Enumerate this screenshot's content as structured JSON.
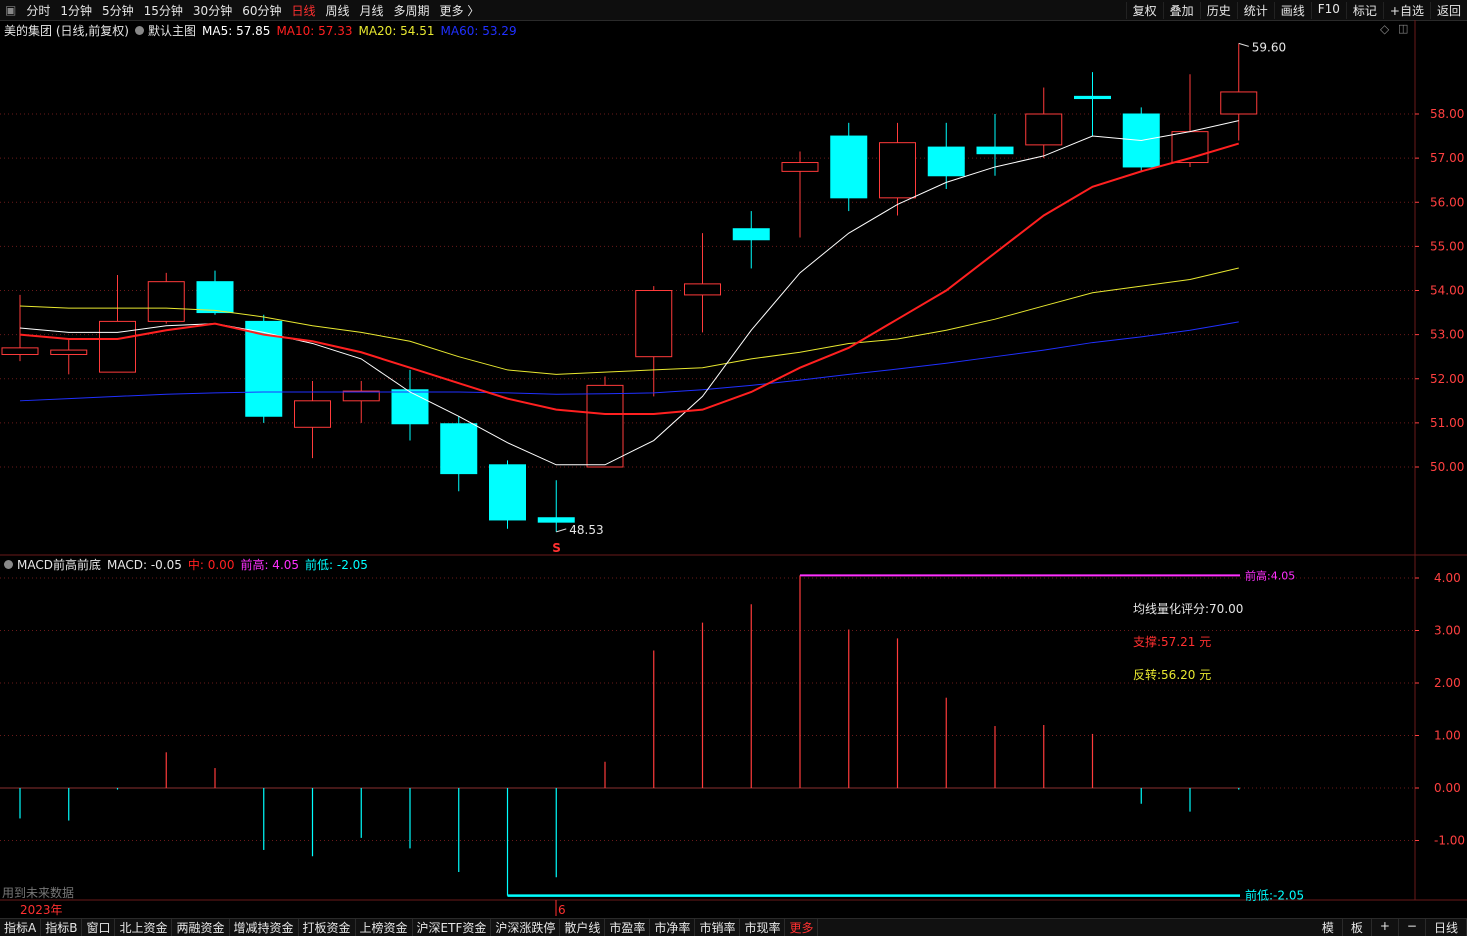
{
  "toolbar": {
    "periods": [
      "分时",
      "1分钟",
      "5分钟",
      "15分钟",
      "30分钟",
      "60分钟",
      "日线",
      "周线",
      "月线",
      "多周期",
      "更多 〉"
    ],
    "active_period": "日线",
    "right_items": [
      "复权",
      "叠加",
      "历史",
      "统计",
      "画线",
      "F10",
      "标记",
      "+自选",
      "返回"
    ]
  },
  "main_legend": {
    "title": "美的集团 (日线,前复权)",
    "indicator": "默认主图",
    "ma5": "MA5: 57.85",
    "ma10": "MA10: 57.33",
    "ma20": "MA20: 54.51",
    "ma60": "MA60: 53.29"
  },
  "macd_legend": {
    "title": "MACD前高前底",
    "macd": "MACD: -0.05",
    "mid": "中: 0.00",
    "high": "前高: 4.05",
    "low": "前低: -2.05"
  },
  "annotations": {
    "high_label": "59.60",
    "low_label": "48.53",
    "score": "均线量化评分:70.00",
    "support": "支撑:57.21 元",
    "reversal": "反转:56.20 元",
    "prev_high_tag": "前高:4.05",
    "prev_low_tag": "前低:-2.05",
    "future_data": "用到未来数据",
    "year_label": "2023年",
    "month_label": "6",
    "s_marker": "S"
  },
  "bottom_bar": {
    "items": [
      "指标A",
      "指标B",
      "窗口",
      "北上资金",
      "两融资金",
      "增减持资金",
      "打板资金",
      "上榜资金",
      "沪深ETF资金",
      "沪深涨跌停",
      "散户线",
      "市盈率",
      "市净率",
      "市销率",
      "市现率",
      "更多"
    ],
    "active": "更多",
    "right_items": [
      "模",
      "板",
      "+",
      "−",
      "日线"
    ]
  },
  "colors": {
    "up": "#ff3b3b",
    "down": "#00ffff",
    "ma5": "#ffffff",
    "ma10": "#ff2020",
    "ma20": "#e8e830",
    "ma60": "#2030ff",
    "macd_high_line": "#ff30ff",
    "macd_low_line": "#00ffff",
    "grid": "#6a1a1a"
  },
  "chart_data": [
    {
      "type": "candlestick",
      "title": "美的集团 (日线,前复权)",
      "y_ticks": [
        50.0,
        51.0,
        52.0,
        53.0,
        54.0,
        55.0,
        56.0,
        57.0,
        58.0
      ],
      "ylim": [
        48.2,
        60.0
      ],
      "candles": [
        {
          "o": 52.55,
          "c": 52.7,
          "h": 53.9,
          "l": 52.4
        },
        {
          "o": 52.55,
          "c": 52.65,
          "h": 52.9,
          "l": 52.1
        },
        {
          "o": 52.15,
          "c": 53.3,
          "h": 54.35,
          "l": 52.15
        },
        {
          "o": 53.3,
          "c": 54.2,
          "h": 54.4,
          "l": 53.25
        },
        {
          "o": 54.2,
          "c": 53.5,
          "h": 54.45,
          "l": 53.45
        },
        {
          "o": 53.3,
          "c": 51.15,
          "h": 53.45,
          "l": 51.0
        },
        {
          "o": 50.9,
          "c": 51.5,
          "h": 51.95,
          "l": 50.2
        },
        {
          "o": 51.5,
          "c": 51.72,
          "h": 51.95,
          "l": 51.0
        },
        {
          "o": 51.75,
          "c": 50.98,
          "h": 52.2,
          "l": 50.6
        },
        {
          "o": 50.98,
          "c": 49.85,
          "h": 51.15,
          "l": 49.45
        },
        {
          "o": 50.05,
          "c": 48.8,
          "h": 50.15,
          "l": 48.6
        },
        {
          "o": 48.85,
          "c": 48.75,
          "h": 49.7,
          "l": 48.53
        },
        {
          "o": 50.0,
          "c": 51.85,
          "h": 52.05,
          "l": 50.0
        },
        {
          "o": 52.5,
          "c": 54.0,
          "h": 54.1,
          "l": 51.6
        },
        {
          "o": 53.9,
          "c": 54.15,
          "h": 55.3,
          "l": 53.05
        },
        {
          "o": 55.4,
          "c": 55.15,
          "h": 55.8,
          "l": 54.5
        },
        {
          "o": 56.7,
          "c": 56.9,
          "h": 57.15,
          "l": 55.2
        },
        {
          "o": 57.5,
          "c": 56.1,
          "h": 57.8,
          "l": 55.8
        },
        {
          "o": 56.1,
          "c": 57.35,
          "h": 57.8,
          "l": 55.7
        },
        {
          "o": 57.25,
          "c": 56.6,
          "h": 57.8,
          "l": 56.3
        },
        {
          "o": 57.25,
          "c": 57.1,
          "h": 58.0,
          "l": 56.6
        },
        {
          "o": 57.3,
          "c": 58.0,
          "h": 58.6,
          "l": 57.0
        },
        {
          "o": 58.4,
          "c": 58.35,
          "h": 58.95,
          "l": 57.5
        },
        {
          "o": 58.0,
          "c": 56.8,
          "h": 58.15,
          "l": 56.7
        },
        {
          "o": 56.9,
          "c": 57.6,
          "h": 58.9,
          "l": 56.8
        },
        {
          "o": 58.0,
          "c": 58.5,
          "h": 59.6,
          "l": 57.4
        }
      ],
      "ma5": [
        53.15,
        53.05,
        53.05,
        53.2,
        53.25,
        53.05,
        52.8,
        52.45,
        51.7,
        51.15,
        50.55,
        50.05,
        50.05,
        50.6,
        51.6,
        53.1,
        54.4,
        55.3,
        55.95,
        56.45,
        56.8,
        57.05,
        57.5,
        57.4,
        57.6,
        57.85
      ],
      "ma10": [
        53.0,
        52.9,
        52.9,
        53.1,
        53.25,
        53.0,
        52.85,
        52.6,
        52.25,
        51.9,
        51.55,
        51.3,
        51.2,
        51.2,
        51.3,
        51.7,
        52.25,
        52.7,
        53.35,
        54.0,
        54.85,
        55.7,
        56.35,
        56.7,
        57.0,
        57.33
      ],
      "ma20": [
        53.65,
        53.6,
        53.6,
        53.6,
        53.55,
        53.4,
        53.2,
        53.05,
        52.85,
        52.5,
        52.2,
        52.1,
        52.15,
        52.2,
        52.25,
        52.45,
        52.6,
        52.8,
        52.9,
        53.1,
        53.35,
        53.65,
        53.95,
        54.1,
        54.25,
        54.51
      ],
      "ma60": [
        51.5,
        51.55,
        51.6,
        51.65,
        51.68,
        51.7,
        51.7,
        51.7,
        51.7,
        51.7,
        51.68,
        51.65,
        51.66,
        51.68,
        51.75,
        51.85,
        51.97,
        52.1,
        52.22,
        52.35,
        52.5,
        52.65,
        52.82,
        52.95,
        53.1,
        53.29
      ]
    },
    {
      "type": "bar",
      "title": "MACD前高前底",
      "y_ticks": [
        -1.0,
        0.0,
        1.0,
        2.0,
        3.0,
        4.0
      ],
      "ylim": [
        -2.2,
        4.2
      ],
      "values": [
        -0.58,
        -0.62,
        -0.03,
        0.68,
        0.38,
        -1.18,
        -1.3,
        -0.95,
        -1.15,
        -1.6,
        -2.05,
        -1.7,
        0.5,
        2.62,
        3.15,
        3.5,
        4.05,
        3.02,
        2.85,
        1.72,
        1.18,
        1.2,
        1.03,
        -0.3,
        -0.45,
        -0.03
      ],
      "prev_high": 4.05,
      "prev_low": -2.05
    }
  ]
}
